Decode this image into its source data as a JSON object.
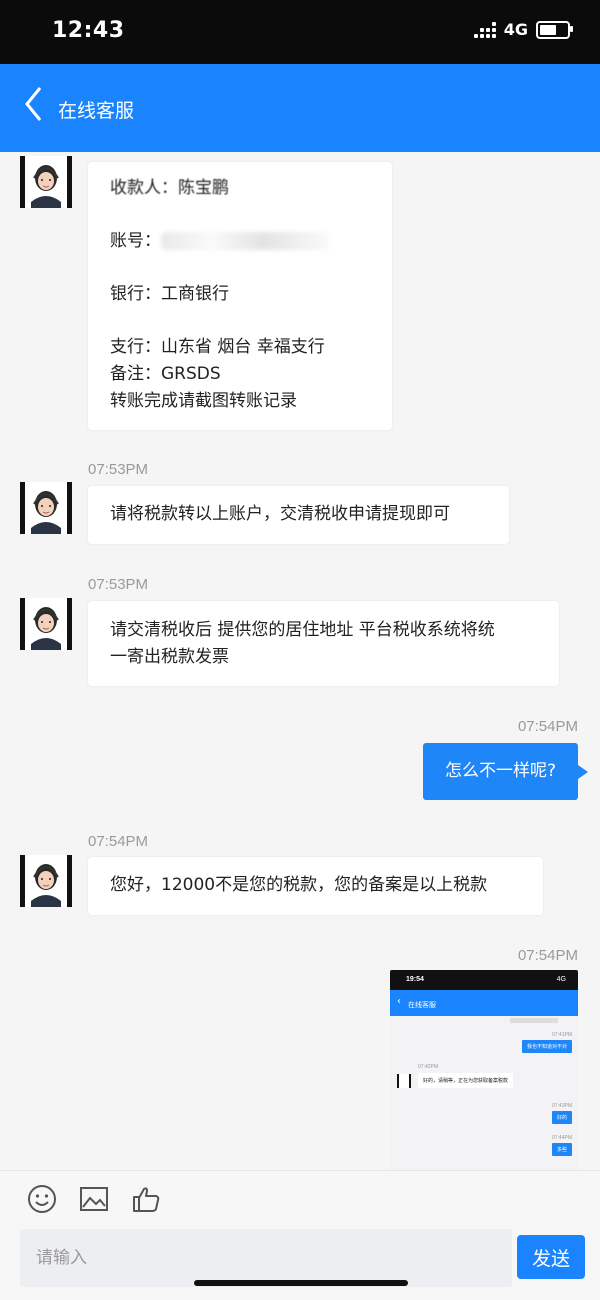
{
  "status_bar": {
    "time": "12:43",
    "network": "4G"
  },
  "header": {
    "title": "在线客服"
  },
  "messages": {
    "m1": {
      "payee": "收款人：陈宝鹏",
      "account_label": "账号：",
      "account_partial": "62122",
      "account_tail": "1075150",
      "bank": "银行：工商银行",
      "branch": "支行：山东省 烟台 幸福支行",
      "remark": "备注：GRSDS",
      "note": "转账完成请截图转账记录"
    },
    "m2": {
      "time": "07:53PM",
      "text": "请将税款转以上账户，交清税收申请提现即可"
    },
    "m3": {
      "time": "07:53PM",
      "line1": "请交清税收后 提供您的居住地址 平台税收系统将统",
      "line2": "一寄出税款发票"
    },
    "m4": {
      "time": "07:54PM",
      "text": "怎么不一样呢?"
    },
    "m5": {
      "time": "07:54PM",
      "text": "您好，12000不是您的税款，您的备案是以上税款"
    },
    "m6": {
      "time": "07:54PM",
      "screenshot": {
        "status_time": "19:54",
        "status_net": "4G",
        "title": "在线客服",
        "ts1": "07:41PM",
        "out1": "我也不知道对不对",
        "ts2": "07:42PM",
        "in1": "好的，请稍等，正在为您获取备案税款",
        "ts3": "07:43PM",
        "out2": "好的",
        "ts4": "07:44PM",
        "out3": "多些"
      }
    }
  },
  "input": {
    "placeholder": "请输入",
    "send_label": "发送"
  },
  "colors": {
    "brand": "#1a84ff",
    "bubble_out": "#1f86f7",
    "background": "#f5f5f6"
  }
}
